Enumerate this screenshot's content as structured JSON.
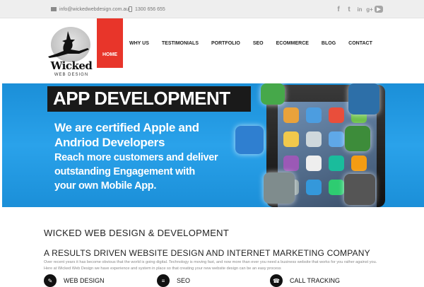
{
  "topbar": {
    "email": "info@wickedwebdesign.com.au",
    "phone": "1300 656 655",
    "social": [
      {
        "name": "facebook-icon",
        "glyph": "f"
      },
      {
        "name": "twitter-icon",
        "glyph": "t"
      },
      {
        "name": "linkedin-icon",
        "glyph": "in"
      },
      {
        "name": "google-plus-icon",
        "glyph": "g+"
      },
      {
        "name": "youtube-icon",
        "glyph": "▶"
      }
    ]
  },
  "logo": {
    "word": "Wicked",
    "sub": "WEB DESIGN"
  },
  "nav": {
    "items": [
      "HOME",
      "WHY US",
      "TESTIMONIALS",
      "PORTFOLIO",
      "SEO",
      "ECOMMERCE",
      "BLOG",
      "CONTACT"
    ],
    "active": "HOME"
  },
  "banner": {
    "title": "APP DEVELOPMENT",
    "line1": "We are certified Apple and",
    "line2": "Andriod Developers",
    "line3": "Reach more customers and deliver",
    "line4": "outstanding Engagement with",
    "line5": "your own Mobile App."
  },
  "content": {
    "title": "WICKED WEB DESIGN & DEVELOPMENT",
    "subtitle": "A RESULTS DRIVEN WEBSITE DESIGN AND INTERNET MARKETING COMPANY",
    "paragraph": "Over recent years it has become obvious that the world is going digital. Technology is moving fast, and now more than ever you need a business website that works for you rather against you. Here at Wicked Web Design we have experience and system in place so that creating your new website design can be an easy process"
  },
  "features": {
    "web_design": "WEB DESIGN",
    "seo": "SEO",
    "call_tracking": "CALL TRACKING"
  },
  "colors": {
    "accent": "#e8352a",
    "banner": "#2196de",
    "topbar": "#eeeeee"
  }
}
